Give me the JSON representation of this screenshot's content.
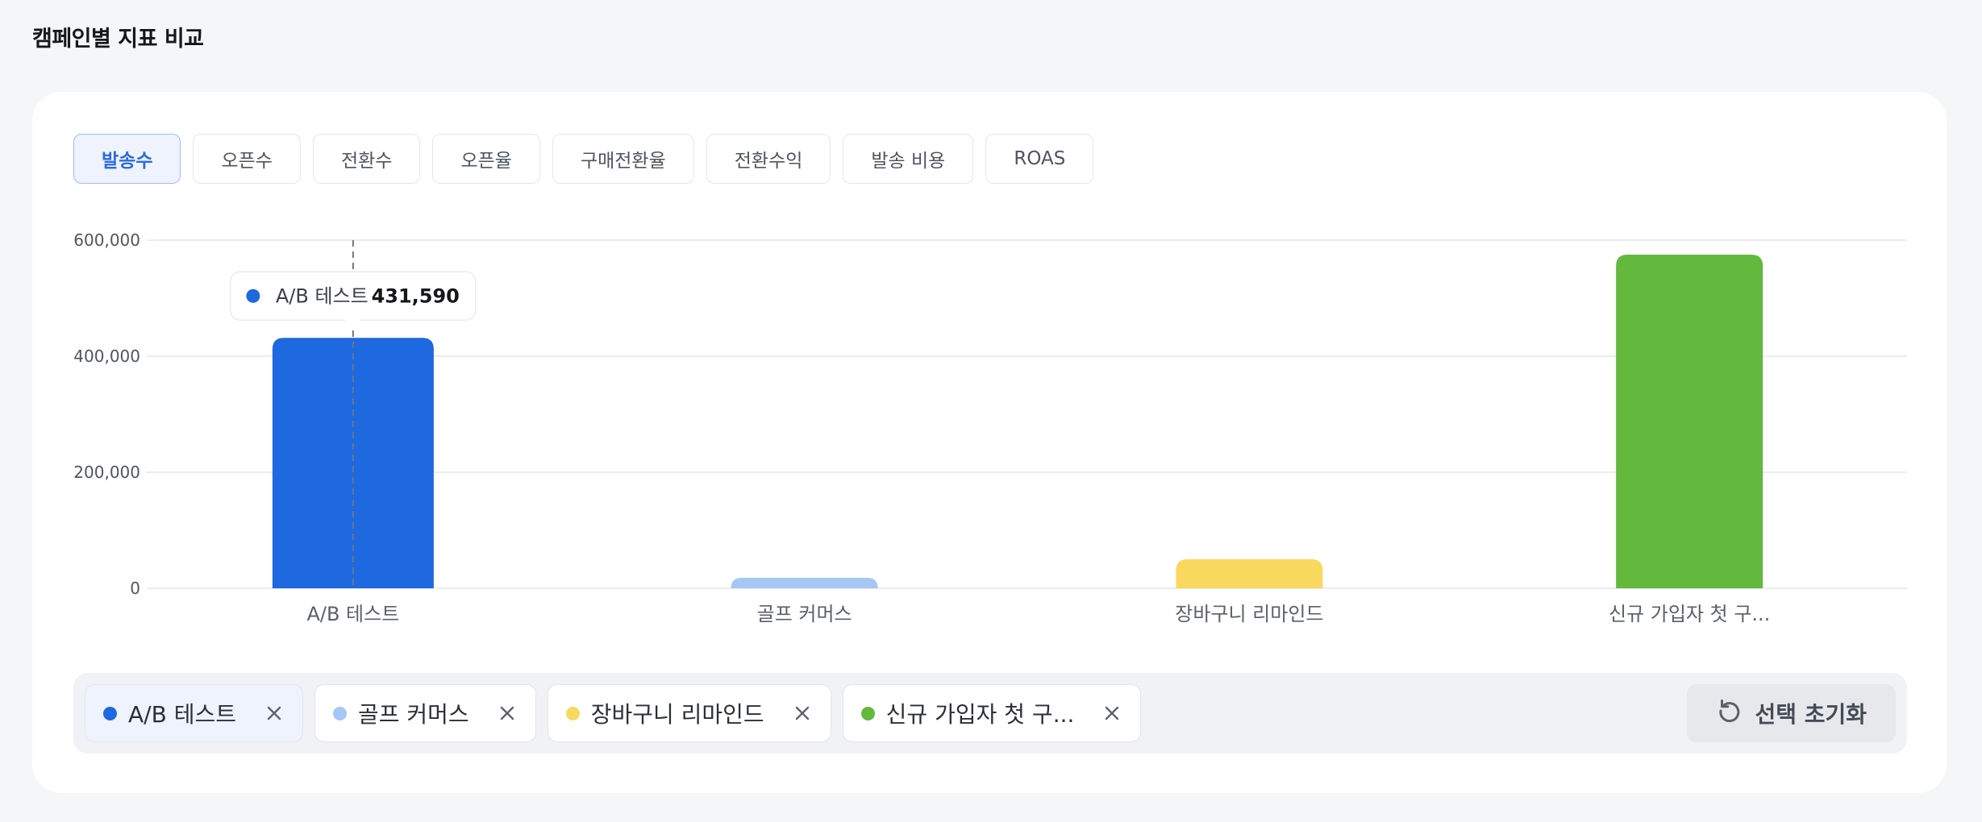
{
  "page": {
    "title": "캠페인별 지표 비교"
  },
  "tabs": [
    {
      "label": "발송수",
      "active": true
    },
    {
      "label": "오픈수",
      "active": false
    },
    {
      "label": "전환수",
      "active": false
    },
    {
      "label": "오픈율",
      "active": false
    },
    {
      "label": "구매전환율",
      "active": false
    },
    {
      "label": "전환수익",
      "active": false
    },
    {
      "label": "발송 비용",
      "active": false
    },
    {
      "label": "ROAS",
      "active": false
    }
  ],
  "colors": {
    "ab": "#1e68e0",
    "golf": "#a6c6f6",
    "cart": "#f9d85f",
    "signup": "#62b93e",
    "grid": "#e3e5e9",
    "tick": "#4e5560"
  },
  "chart_data": {
    "type": "bar",
    "categories": [
      "A/B 테스트",
      "골프 커머스",
      "장바구니 리마인드",
      "신규 가입자 첫 구..."
    ],
    "values": [
      431590,
      18000,
      50000,
      575000
    ],
    "colors": [
      "#1e68e0",
      "#a6c6f6",
      "#f9d85f",
      "#62b93e"
    ],
    "ylim": [
      0,
      600000
    ],
    "yticks": [
      0,
      200000,
      400000,
      600000
    ],
    "ytick_labels": [
      "0",
      "200,000",
      "400,000",
      "600,000"
    ],
    "grid": true,
    "tooltip": {
      "category_index": 0,
      "label": "A/B 테스트",
      "value_label": "431,590"
    }
  },
  "legend": {
    "chips": [
      {
        "label": "A/B 테스트",
        "color": "#1e68e0",
        "selected": true
      },
      {
        "label": "골프 커머스",
        "color": "#a6c6f6",
        "selected": false
      },
      {
        "label": "장바구니 리마인드",
        "color": "#f9d85f",
        "selected": false
      },
      {
        "label": "신규 가입자 첫 구...",
        "color": "#62b93e",
        "selected": false
      }
    ],
    "reset_label": "선택 초기화"
  }
}
